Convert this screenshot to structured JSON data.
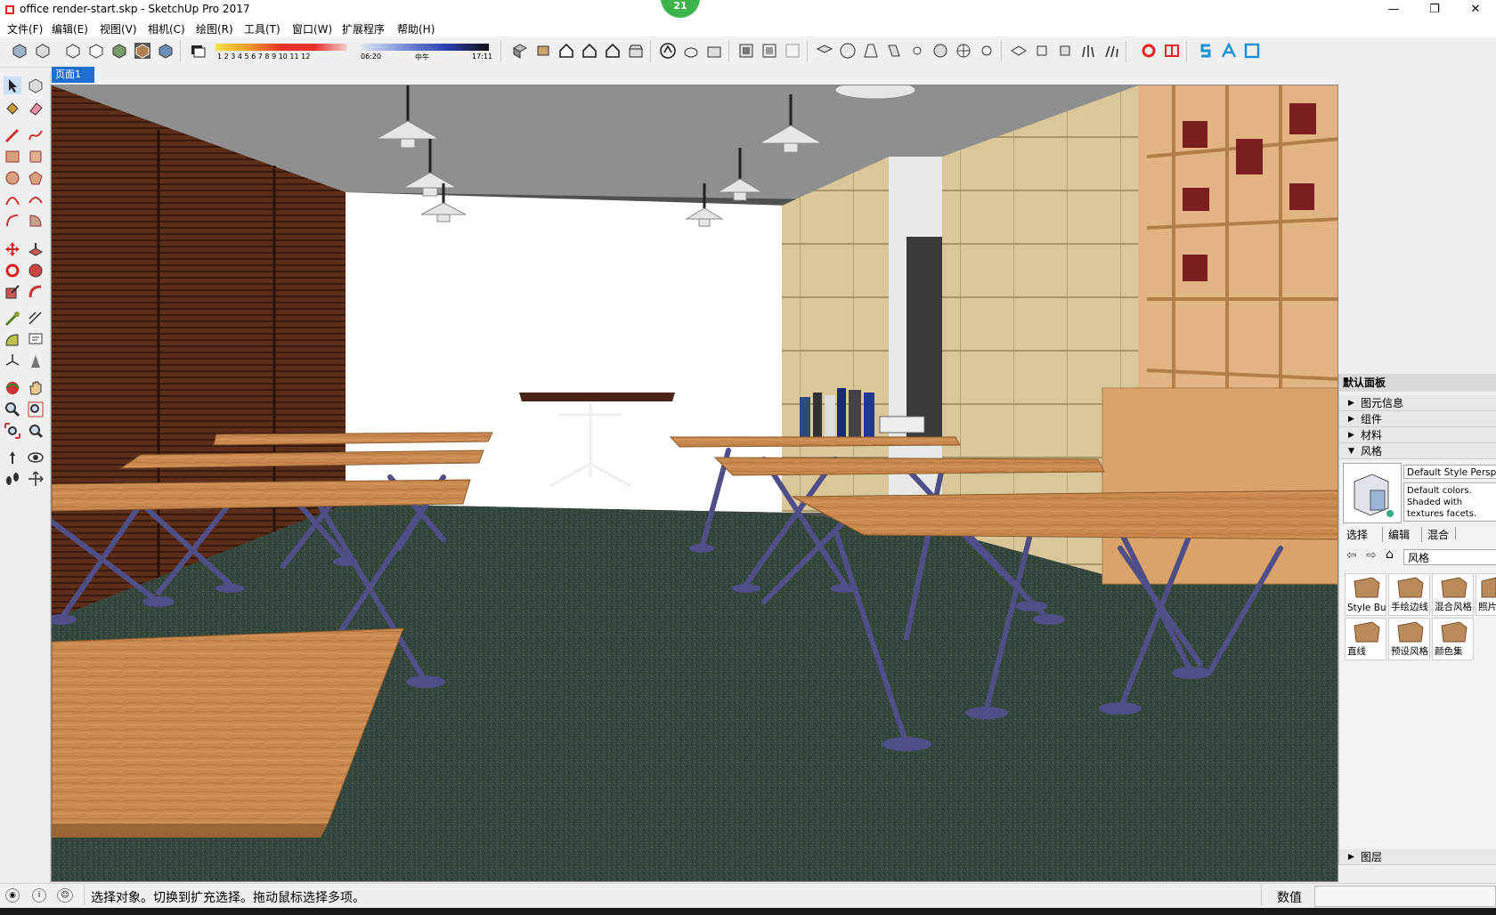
{
  "window": {
    "title": "office render-start.skp - SketchUp Pro 2017",
    "badge": "21",
    "minimize": "—",
    "restore": "❐",
    "close": "✕"
  },
  "menu": [
    "文件(F)",
    "编辑(E)",
    "视图(V)",
    "相机(C)",
    "绘图(R)",
    "工具(T)",
    "窗口(W)",
    "扩展程序",
    "帮助(H)"
  ],
  "shadow_slider": {
    "months": "1 2 3 4 5 6 7 8 9 10 11 12",
    "time_start": "06:20",
    "time_mid": "中午",
    "time_end": "17:11"
  },
  "scene_tab": "页面1",
  "right_panel": {
    "title": "默认面板",
    "sections": [
      {
        "label": "图元信息",
        "expanded": false
      },
      {
        "label": "组件",
        "expanded": false
      },
      {
        "label": "材料",
        "expanded": false
      },
      {
        "label": "风格",
        "expanded": true
      }
    ],
    "style_name": "Default Style Perspective",
    "style_desc": "Default colors. Shaded with textures facets. Sky enabled. Brown",
    "tabs": [
      "选择",
      "编辑",
      "混合"
    ],
    "dropdown_value": "风格",
    "tiles": [
      "Style Buil",
      "手绘边线",
      "混合风格",
      "照片",
      "直线",
      "预设风格",
      "颜色集"
    ],
    "layers_section": "图层"
  },
  "status": {
    "message": "选择对象。切换到扩充选择。拖动鼠标选择多项。",
    "value_label": "数值",
    "value_input": ""
  },
  "colors": {
    "accent": "#1e6fd1",
    "ceiling": "#8f8f8f",
    "floor": "#34463c",
    "wood": "#c9894f",
    "table_legs": "#4f4e86"
  }
}
